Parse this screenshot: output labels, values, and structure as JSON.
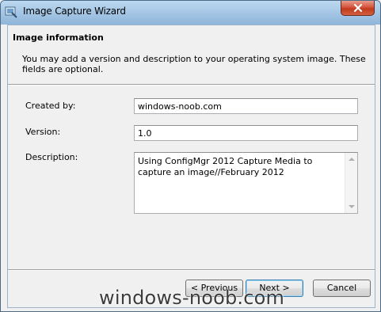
{
  "window": {
    "title": "Image Capture Wizard",
    "icon": "wizard-icon",
    "close_icon": "close-icon"
  },
  "header": {
    "title": "Image information",
    "description": "You may add a version and description to your operating system image.  These fields are optional."
  },
  "form": {
    "created_by": {
      "label": "Created by:",
      "value": "windows-noob.com"
    },
    "version": {
      "label": "Version:",
      "value": "1.0"
    },
    "description": {
      "label": "Description:",
      "value": "Using ConfigMgr 2012 Capture Media to capture an image//February 2012"
    }
  },
  "buttons": {
    "previous": "< Previous",
    "next": "Next >",
    "cancel": "Cancel"
  },
  "watermark": "windows-noob.com",
  "colors": {
    "titlebar": "#a7c8e6",
    "close_button": "#c13a1d",
    "dialog_background": "#f0f0f0",
    "default_button_border": "#3c7fb1"
  }
}
